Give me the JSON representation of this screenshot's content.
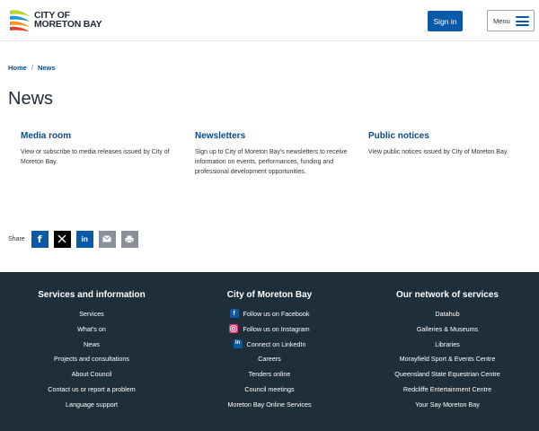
{
  "header": {
    "logo_line1": "CITY OF",
    "logo_line2": "MORETON BAY",
    "signin_label": "Sign in",
    "menu_label": "Menu"
  },
  "breadcrumb": {
    "home": "Home",
    "separator": "/",
    "current": "News"
  },
  "page_title": "News",
  "cards": [
    {
      "title": "Media room",
      "description": "View or subscribe to media releases issued by City of Moreton Bay."
    },
    {
      "title": "Newsletters",
      "description": "Sign up to City of Moreton Bay's newsletters to receive information on events, performances, funding and professional development opportunities."
    },
    {
      "title": "Public notices",
      "description": "View public notices issued by City of Moreton Bay."
    }
  ],
  "share": {
    "label": "Share",
    "buttons": [
      {
        "icon": "facebook-icon",
        "color": "#0a5aa9"
      },
      {
        "icon": "x-icon",
        "color": "#000000"
      },
      {
        "icon": "linkedin-icon",
        "color": "#0a5aa9"
      },
      {
        "icon": "email-icon",
        "color": "#8a9099"
      },
      {
        "icon": "print-icon",
        "color": "#8a9099"
      }
    ]
  },
  "footer": {
    "colors": {
      "background": "#1e2f3a"
    },
    "columns": [
      {
        "heading": "Services and information",
        "links": [
          "Services",
          "What's on",
          "News",
          "Projects and consultations",
          "About Council",
          "Contact us or report a problem",
          "Language support"
        ]
      },
      {
        "heading": "City of Moreton Bay",
        "links": [
          "Follow us on Facebook",
          "Follow us on Instagram",
          "Connect on LinkedIn",
          "Careers",
          "Tenders online",
          "Council meetings",
          "Moreton Bay Online Services"
        ]
      },
      {
        "heading": "Our network of services",
        "links": [
          "Datahub",
          "Galleries & Museums",
          "Libraries",
          "Morayfield Sport & Events Centre",
          "Queensland State Equestrian Centre",
          "Redcliffe Entertainment Centre",
          "Your Say Moreton Bay"
        ]
      }
    ]
  }
}
